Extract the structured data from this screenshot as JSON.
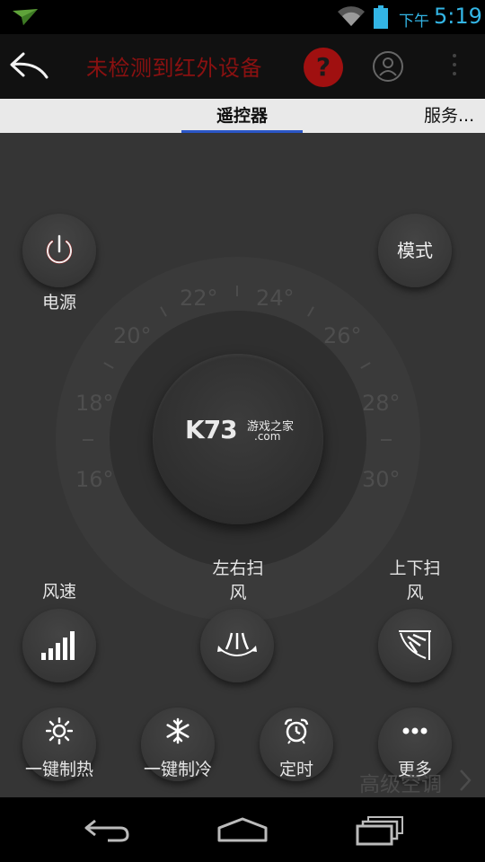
{
  "status_bar": {
    "ampm": "下午",
    "time": "5:19",
    "accent": "#33b5e5"
  },
  "action_bar": {
    "title": "未检测到红外设备",
    "help_symbol": "?",
    "title_color": "#8a1111",
    "icons": [
      "back-arrow-icon",
      "help-icon",
      "user-icon",
      "overflow-menu-icon"
    ]
  },
  "tabs": [
    {
      "label": "遥控器",
      "selected": true
    },
    {
      "label": "服务..."
    }
  ],
  "dial": {
    "temps": [
      "16°",
      "18°",
      "20°",
      "22°",
      "24°",
      "26°",
      "28°",
      "30°"
    ]
  },
  "watermark": {
    "main": "K73",
    "cn": "游戏之家",
    "com": ".com"
  },
  "controls": {
    "power_label": "电源",
    "mode_label": "模式",
    "fan_speed_label": "风速",
    "swing_lr_label_line1": "左右扫",
    "swing_lr_label_line2": "风",
    "swing_ud_label_line1": "上下扫",
    "swing_ud_label_line2": "风",
    "heat_label": "一键制热",
    "cool_label": "一键制冷",
    "timer_label": "定时",
    "more_label": "更多"
  },
  "advanced_label": "高级空调",
  "nav_bar": {
    "icons": [
      "nav-back-icon",
      "nav-home-icon",
      "nav-recents-icon"
    ]
  }
}
